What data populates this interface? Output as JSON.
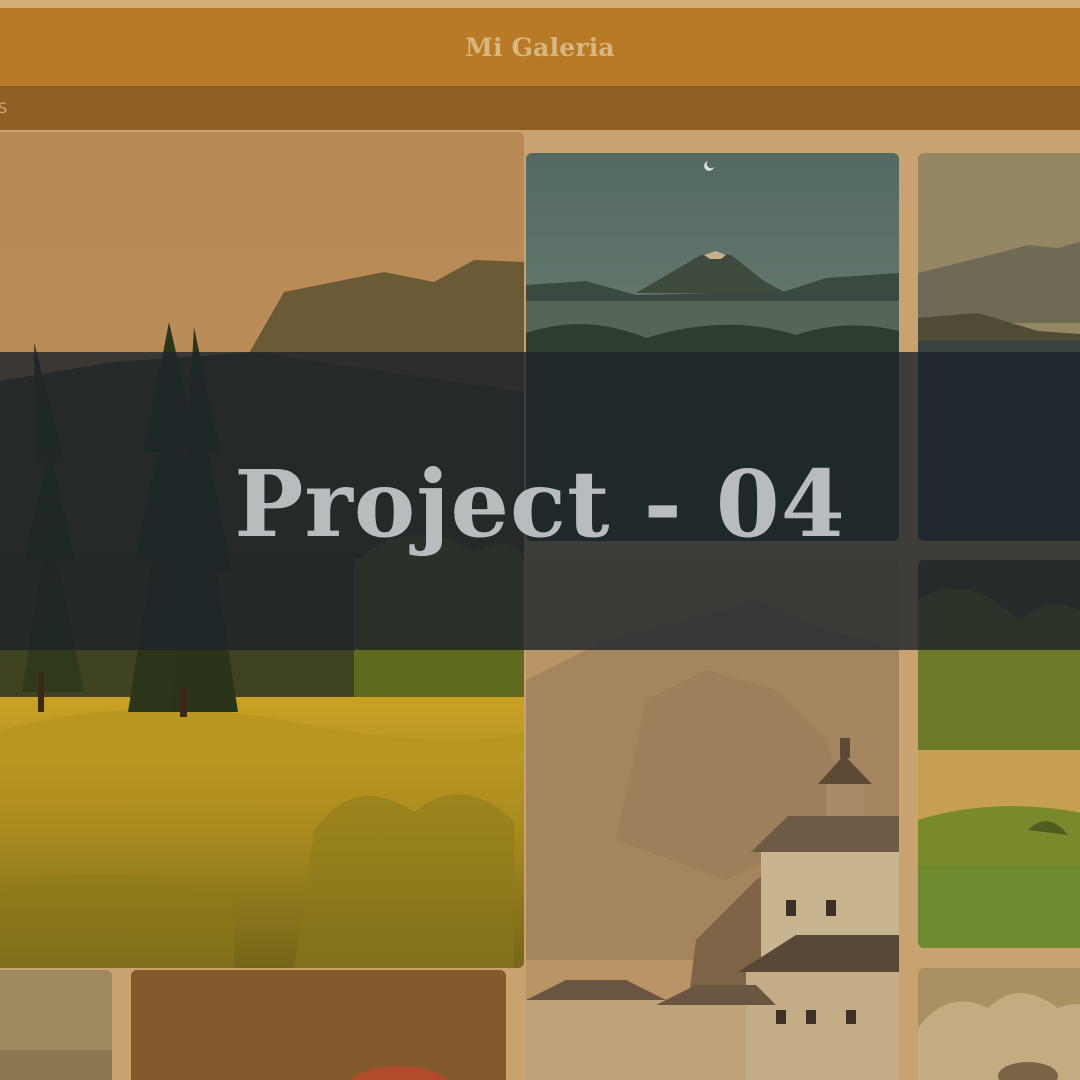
{
  "header": {
    "title": "Mi Galeria"
  },
  "subnav": {
    "item_label": "os"
  },
  "overlay": {
    "title": "Project - 04"
  },
  "colors": {
    "header_bg": "#b87a27",
    "subnav_bg": "#8e5e22",
    "page_bg": "#c9a36f",
    "overlay_bg": "#1c232b",
    "overlay_text": "#b9bcbe"
  },
  "gallery": {
    "tiles": [
      {
        "name": "meadow-forest-photo"
      },
      {
        "name": "volcano-lake-photo"
      },
      {
        "name": "mountain-lake-photo"
      },
      {
        "name": "alpine-village-photo"
      },
      {
        "name": "green-hills-photo"
      },
      {
        "name": "small-landscape-photo"
      },
      {
        "name": "brown-placeholder-tile"
      },
      {
        "name": "cloudy-sky-photo"
      }
    ]
  }
}
